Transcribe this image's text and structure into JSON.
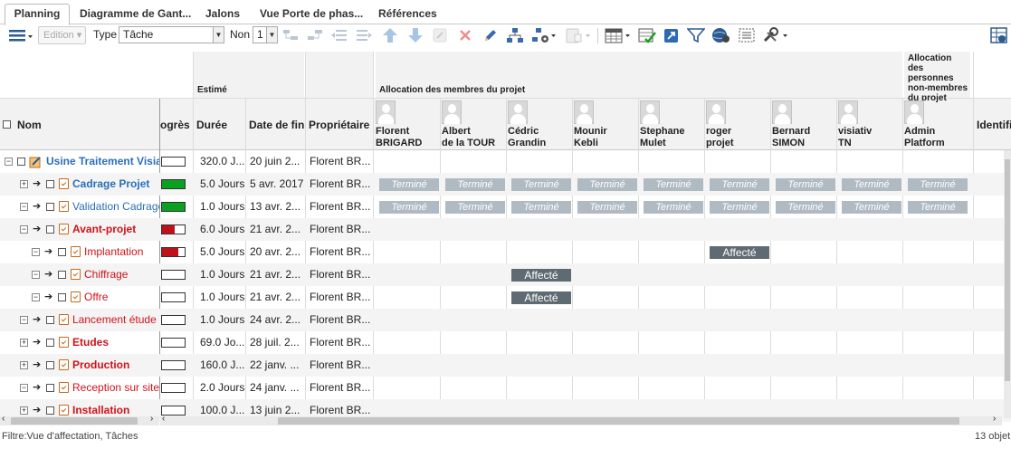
{
  "tabs": [
    {
      "label": "Planning",
      "active": true
    },
    {
      "label": "Diagramme de Gant...",
      "active": false
    },
    {
      "label": "Jalons",
      "active": false
    },
    {
      "label": "Vue Porte de phas...",
      "active": false
    },
    {
      "label": "Références",
      "active": false
    }
  ],
  "toolbar": {
    "edition_label": "Edition",
    "type_label": "Type",
    "type_value": "Tâche",
    "non_label": "Non",
    "non_value": "1"
  },
  "columns": {
    "nom": "Nom",
    "progres": "ogrès",
    "estime_group": "Estimé",
    "duree": "Durée",
    "date_fin": "Date de fin",
    "proprietaire": "Propriétaire",
    "allocation_membres": "Allocation des membres du projet",
    "allocation_non_membres": "Allocation des personnes non-membres du projet",
    "identifiant": "Identifia"
  },
  "members": [
    {
      "first": "Florent",
      "last": "BRIGARD"
    },
    {
      "first": "Albert",
      "last": "de la TOUR"
    },
    {
      "first": "Cédric",
      "last": "Grandin"
    },
    {
      "first": "Mounir",
      "last": "Kebli"
    },
    {
      "first": "Stephane",
      "last": "Mulet"
    },
    {
      "first": "roger",
      "last": "projet"
    },
    {
      "first": "Bernard",
      "last": "SIMON"
    },
    {
      "first": "visiativ",
      "last": "TN"
    }
  ],
  "non_members": [
    {
      "first": "Admin",
      "last": "Platform"
    }
  ],
  "status_labels": {
    "done": "Terminé",
    "assigned": "Affecté"
  },
  "rows": [
    {
      "name": "Usine Traitement Visiat",
      "level": 0,
      "expand": "−",
      "color": "blue",
      "bold": true,
      "progress": 0,
      "duree": "320.0 J...",
      "fin": "20 juin 2...",
      "owner": "Florent BR...",
      "alloc": []
    },
    {
      "name": "Cadrage Projet",
      "level": 1,
      "expand": "+",
      "color": "blue",
      "bold": true,
      "progress": 1,
      "progress_color": "#0aa020",
      "duree": "5.0 Jours",
      "fin": "5 avr. 2017",
      "owner": "Florent BR...",
      "alloc": [
        "done",
        "done",
        "done",
        "done",
        "done",
        "done",
        "done",
        "done",
        "done"
      ]
    },
    {
      "name": "Validation Cadrage",
      "level": 1,
      "expand": "−",
      "color": "blue",
      "bold": false,
      "progress": 1,
      "progress_color": "#0aa020",
      "duree": "1.0 Jours",
      "fin": "13 avr. 2...",
      "owner": "Florent BR...",
      "alloc": [
        "done",
        "done",
        "done",
        "done",
        "done",
        "done",
        "done",
        "done",
        "done"
      ]
    },
    {
      "name": "Avant-projet",
      "level": 1,
      "expand": "−",
      "color": "red",
      "bold": true,
      "progress": 0.55,
      "progress_color": "#c0111a",
      "duree": "6.0 Jours",
      "fin": "21 avr. 2...",
      "owner": "Florent BR...",
      "alloc": []
    },
    {
      "name": "Implantation",
      "level": 2,
      "expand": "−",
      "color": "red",
      "bold": false,
      "progress": 0.7,
      "progress_color": "#c0111a",
      "duree": "5.0 Jours",
      "fin": "20 avr. 2...",
      "owner": "Florent BR...",
      "alloc": [
        "",
        "",
        "",
        "",
        "",
        "assigned",
        "",
        "",
        ""
      ]
    },
    {
      "name": "Chiffrage",
      "level": 2,
      "expand": "−",
      "color": "red",
      "bold": false,
      "progress": 0,
      "duree": "1.0 Jours",
      "fin": "21 avr. 2...",
      "owner": "Florent BR...",
      "alloc": [
        "",
        "",
        "assigned",
        "",
        "",
        "",
        "",
        "",
        ""
      ]
    },
    {
      "name": "Offre",
      "level": 2,
      "expand": "−",
      "color": "red",
      "bold": false,
      "progress": 0,
      "duree": "1.0 Jours",
      "fin": "21 avr. 2...",
      "owner": "Florent BR...",
      "alloc": [
        "",
        "",
        "assigned",
        "",
        "",
        "",
        "",
        "",
        ""
      ]
    },
    {
      "name": "Lancement étude",
      "level": 1,
      "expand": "−",
      "color": "red",
      "bold": false,
      "progress": 0,
      "duree": "1.0 Jours",
      "fin": "24 avr. 2...",
      "owner": "Florent BR...",
      "alloc": []
    },
    {
      "name": "Etudes",
      "level": 1,
      "expand": "+",
      "color": "red",
      "bold": true,
      "progress": 0,
      "duree": "69.0 Jo...",
      "fin": "28 juil. 2...",
      "owner": "Florent BR...",
      "alloc": []
    },
    {
      "name": "Production",
      "level": 1,
      "expand": "+",
      "color": "red",
      "bold": true,
      "progress": 0,
      "duree": "160.0 J...",
      "fin": "22 janv. ...",
      "owner": "Florent BR...",
      "alloc": []
    },
    {
      "name": "Reception sur site",
      "level": 1,
      "expand": "−",
      "color": "red",
      "bold": false,
      "progress": 0,
      "duree": "2.0 Jours",
      "fin": "24 janv. ...",
      "owner": "Florent BR...",
      "alloc": []
    },
    {
      "name": "Installation",
      "level": 1,
      "expand": "+",
      "color": "red",
      "bold": true,
      "progress": 0,
      "duree": "100.0 J...",
      "fin": "13 juin 2...",
      "owner": "Florent BR...",
      "alloc": []
    }
  ],
  "footer": {
    "filter": "Filtre:Vue d'affectation, Tâches",
    "count": "13 objet"
  }
}
